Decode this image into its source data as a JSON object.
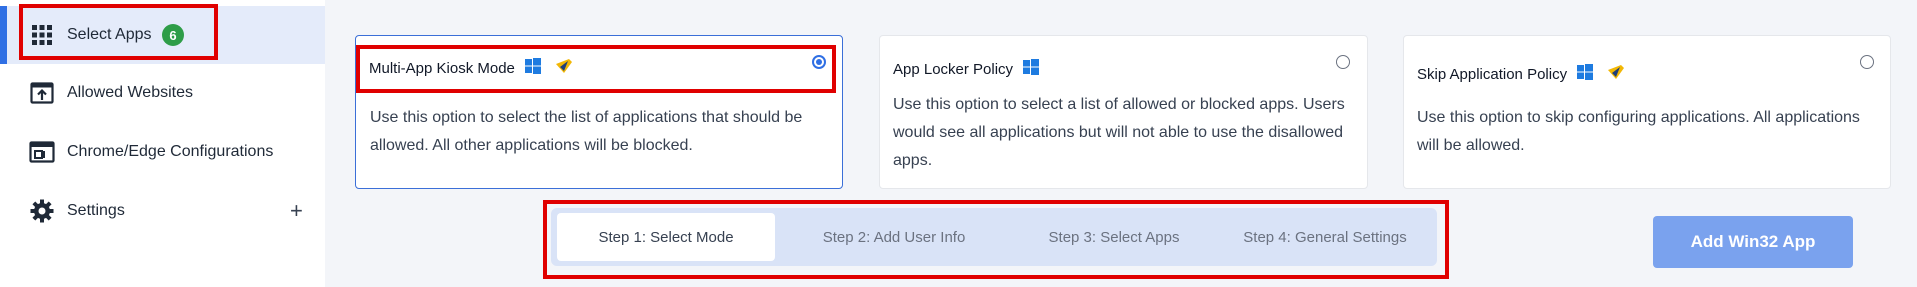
{
  "sidebar": {
    "items": [
      {
        "label": "Select Apps",
        "icon": "grid-icon",
        "badge": "6",
        "active": true
      },
      {
        "label": "Allowed Websites",
        "icon": "upload-window-icon"
      },
      {
        "label": "Chrome/Edge Configurations",
        "icon": "browser-window-icon"
      },
      {
        "label": "Settings",
        "icon": "gear-icon",
        "expand": "+"
      }
    ]
  },
  "cards": [
    {
      "title": "Multi-App Kiosk Mode",
      "description": "Use this option to select the list of applications that should be allowed. All other applications will be blocked.",
      "icons": [
        "windows-icon",
        "lightning-shield-icon"
      ],
      "selected": true
    },
    {
      "title": "App Locker Policy",
      "description": "Use this option to select a list of allowed or blocked apps. Users would see all applications but will not able to use the disallowed apps.",
      "icons": [
        "windows-icon"
      ],
      "selected": false
    },
    {
      "title": "Skip Application Policy",
      "description": "Use this option to skip configuring applications. All applications will be allowed.",
      "icons": [
        "windows-icon",
        "lightning-shield-icon"
      ],
      "selected": false
    }
  ],
  "stepper": {
    "steps": [
      "Step 1: Select Mode",
      "Step 2: Add User Info",
      "Step 3: Select Apps",
      "Step 4: General Settings"
    ],
    "active_index": 0
  },
  "actions": {
    "add_win32": "Add Win32 App"
  },
  "colors": {
    "accent": "#2f6fe4",
    "badge": "#2e9d48",
    "highlight": "#e00000",
    "button": "#7aa2ee"
  }
}
